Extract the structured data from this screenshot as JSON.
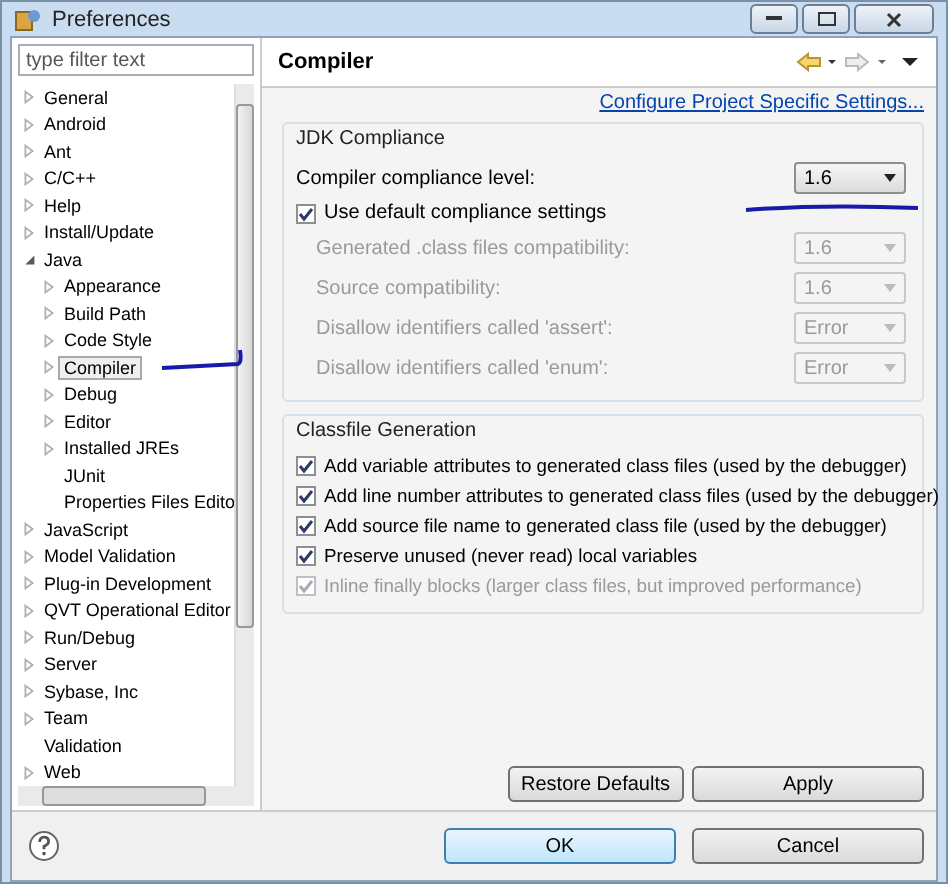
{
  "window": {
    "title": "Preferences"
  },
  "filter": {
    "placeholder": "type filter text"
  },
  "tree": [
    {
      "label": "General",
      "expandable": true,
      "expanded": false,
      "selected": false
    },
    {
      "label": "Android",
      "expandable": true,
      "expanded": false,
      "selected": false
    },
    {
      "label": "Ant",
      "expandable": true,
      "expanded": false,
      "selected": false
    },
    {
      "label": "C/C++",
      "expandable": true,
      "expanded": false,
      "selected": false
    },
    {
      "label": "Help",
      "expandable": true,
      "expanded": false,
      "selected": false
    },
    {
      "label": "Install/Update",
      "expandable": true,
      "expanded": false,
      "selected": false
    },
    {
      "label": "Java",
      "expandable": true,
      "expanded": true,
      "selected": false,
      "children": [
        {
          "label": "Appearance",
          "expandable": true,
          "expanded": false,
          "selected": false
        },
        {
          "label": "Build Path",
          "expandable": true,
          "expanded": false,
          "selected": false
        },
        {
          "label": "Code Style",
          "expandable": true,
          "expanded": false,
          "selected": false
        },
        {
          "label": "Compiler",
          "expandable": true,
          "expanded": false,
          "selected": true
        },
        {
          "label": "Debug",
          "expandable": true,
          "expanded": false,
          "selected": false
        },
        {
          "label": "Editor",
          "expandable": true,
          "expanded": false,
          "selected": false
        },
        {
          "label": "Installed JREs",
          "expandable": true,
          "expanded": false,
          "selected": false
        },
        {
          "label": "JUnit",
          "expandable": false,
          "selected": false
        },
        {
          "label": "Properties Files Edito",
          "expandable": false,
          "selected": false
        }
      ]
    },
    {
      "label": "JavaScript",
      "expandable": true,
      "expanded": false,
      "selected": false
    },
    {
      "label": "Model Validation",
      "expandable": true,
      "expanded": false,
      "selected": false
    },
    {
      "label": "Plug-in Development",
      "expandable": true,
      "expanded": false,
      "selected": false
    },
    {
      "label": "QVT Operational Editor",
      "expandable": true,
      "expanded": false,
      "selected": false
    },
    {
      "label": "Run/Debug",
      "expandable": true,
      "expanded": false,
      "selected": false
    },
    {
      "label": "Server",
      "expandable": true,
      "expanded": false,
      "selected": false
    },
    {
      "label": "Sybase, Inc",
      "expandable": true,
      "expanded": false,
      "selected": false
    },
    {
      "label": "Team",
      "expandable": true,
      "expanded": false,
      "selected": false
    },
    {
      "label": "Validation",
      "expandable": false,
      "selected": false
    },
    {
      "label": "Web",
      "expandable": true,
      "expanded": false,
      "selected": false
    }
  ],
  "page": {
    "title": "Compiler",
    "link": "Configure Project Specific Settings...",
    "jdk_group": {
      "title": "JDK Compliance",
      "compliance_label": "Compiler compliance level:",
      "compliance_value": "1.6",
      "use_default": {
        "label": "Use default compliance settings",
        "checked": true
      },
      "settings": [
        {
          "label": "Generated .class files compatibility:",
          "value": "1.6",
          "disabled": true
        },
        {
          "label": "Source compatibility:",
          "value": "1.6",
          "disabled": true
        },
        {
          "label": "Disallow identifiers called 'assert':",
          "value": "Error",
          "disabled": true
        },
        {
          "label": "Disallow identifiers called 'enum':",
          "value": "Error",
          "disabled": true
        }
      ]
    },
    "classfile_group": {
      "title": "Classfile Generation",
      "options": [
        {
          "label": "Add variable attributes to generated class files (used by the debugger)",
          "checked": true,
          "disabled": false
        },
        {
          "label": "Add line number attributes to generated class files (used by the debugger)",
          "checked": true,
          "disabled": false
        },
        {
          "label": "Add source file name to generated class file (used by the debugger)",
          "checked": true,
          "disabled": false
        },
        {
          "label": "Preserve unused (never read) local variables",
          "checked": true,
          "disabled": false
        },
        {
          "label": "Inline finally blocks (larger class files, but improved performance)",
          "checked": true,
          "disabled": true
        }
      ]
    },
    "buttons": [
      "Restore Defaults",
      "Apply"
    ]
  },
  "dialog_buttons": [
    {
      "label": "OK",
      "default": true
    },
    {
      "label": "Cancel",
      "default": false
    }
  ]
}
